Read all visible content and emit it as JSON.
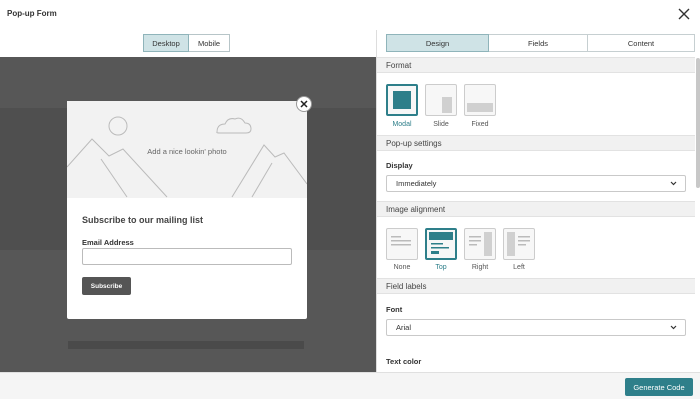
{
  "header": {
    "title": "Pop-up Form"
  },
  "preview": {
    "devices": [
      "Desktop",
      "Mobile"
    ],
    "modal": {
      "photo_text": "Add a nice lookin' photo",
      "title": "Subscribe to our mailing list",
      "email_label": "Email Address",
      "email_value": "",
      "subscribe_label": "Subscribe"
    }
  },
  "panel": {
    "tabs": [
      "Design",
      "Fields",
      "Content"
    ],
    "format": {
      "heading": "Format",
      "options": [
        "Modal",
        "Slide",
        "Fixed"
      ],
      "selected": "Modal"
    },
    "popup_settings": {
      "heading": "Pop-up settings",
      "display_label": "Display",
      "display_value": "Immediately"
    },
    "image_alignment": {
      "heading": "Image alignment",
      "options": [
        "None",
        "Top",
        "Right",
        "Left"
      ],
      "selected": "Top"
    },
    "field_labels": {
      "heading": "Field labels",
      "font_label": "Font",
      "font_value": "Arial",
      "text_color_label": "Text color"
    }
  },
  "footer": {
    "generate_label": "Generate Code"
  },
  "colors": {
    "accent": "#2e7f8a",
    "tab_active": "#cfe3e6",
    "stage": "#575757"
  }
}
